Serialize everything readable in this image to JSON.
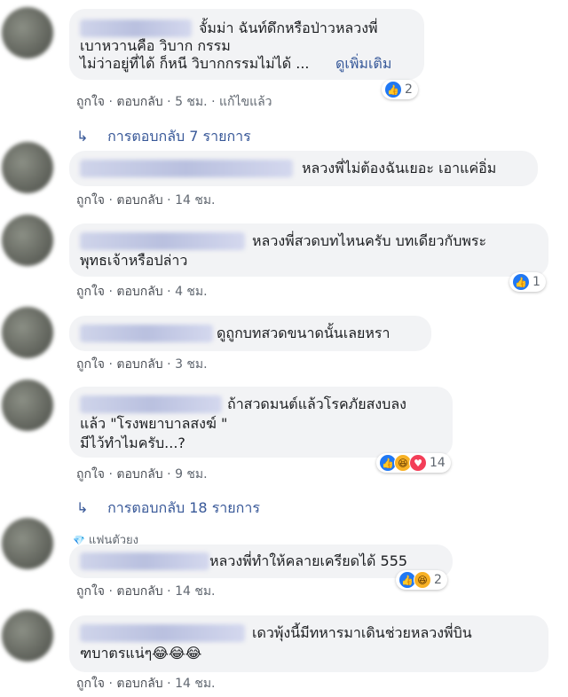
{
  "labels": {
    "like": "ถูกใจ",
    "reply": "ตอบกลับ",
    "dot": "·"
  },
  "comments": [
    {
      "text_lines": [
        "จั้มม่า ฉันท์ดึกหรือป่าวหลวงพี่",
        "เบาหวานคือ วิบาก กรรม",
        "ไม่ว่าอยู่ที่ได้ ก็หนี วิบากกรรมไม่ได้ ..."
      ],
      "see_more": "ดูเพิ่มเติม",
      "time": "5 ชม.",
      "edited": "แก้ไขแล้ว",
      "reaction_count": "2"
    },
    {
      "text_lines": [
        "หลวงพี่ไม่ต้องฉันเยอะ เอาแค่อิ่ม"
      ],
      "time": "14 ชม."
    },
    {
      "text_lines": [
        "หลวงพี่สวดบทไหนครับ บทเดียวกับพระ",
        "พุทธเจ้าหรือปล่าว"
      ],
      "time": "4 ชม.",
      "reaction_count": "1"
    },
    {
      "text_lines": [
        "ดูถูกบทสวดขนาดนั้นเลยหรา"
      ],
      "time": "3 ชม."
    },
    {
      "text_lines": [
        "ถ้าสวดมนต์แล้วโรคภัยสงบลง",
        "แล้ว \"โรงพยาบาลสงฆ์ \"",
        "มีไว้ทำไมครับ...?"
      ],
      "time": "9 ชม.",
      "reaction_count": "14"
    },
    {
      "badge": "แฟนตัวยง",
      "text_lines": [
        "หลวงพี่ทำให้คลายเครียดได้ 555"
      ],
      "time": "14 ชม.",
      "reaction_count": "2"
    },
    {
      "text_lines": [
        "เดวพุ้งนี้มีทหารมาเดินช่วยหลวงพี่บิน",
        "ฑบาตรแน่ๆ😂😂😂"
      ],
      "time": "14 ชม."
    }
  ],
  "replies": [
    {
      "label": "การตอบกลับ 7 รายการ"
    },
    {
      "label": "การตอบกลับ 18 รายการ"
    }
  ],
  "icons": {
    "reply_arrow": "↳",
    "like": "👍",
    "haha": "😆",
    "love": "♥",
    "diamond": "💎"
  },
  "colors": {
    "link": "#385898",
    "bubble": "#f2f3f5",
    "like_blue": "#2078f4"
  }
}
